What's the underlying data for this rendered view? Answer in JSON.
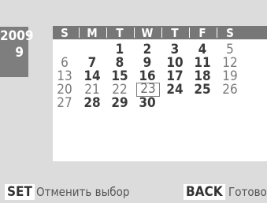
{
  "date": {
    "year": "2009",
    "month": "9"
  },
  "calendar": {
    "weekdays": [
      "S",
      "M",
      "T",
      "W",
      "T",
      "F",
      "S"
    ],
    "weeks": [
      [
        "",
        "",
        "1",
        "2",
        "3",
        "4",
        "5"
      ],
      [
        "6",
        "7",
        "8",
        "9",
        "10",
        "11",
        "12"
      ],
      [
        "13",
        "14",
        "15",
        "16",
        "17",
        "18",
        "19"
      ],
      [
        "20",
        "21",
        "22",
        "23",
        "24",
        "25",
        "26"
      ],
      [
        "27",
        "28",
        "29",
        "30",
        "",
        "",
        ""
      ]
    ],
    "selected_day": "23"
  },
  "footer": {
    "set_key": "SET",
    "set_action": "Отменить выбор",
    "back_key": "BACK",
    "back_action": "Готово"
  }
}
